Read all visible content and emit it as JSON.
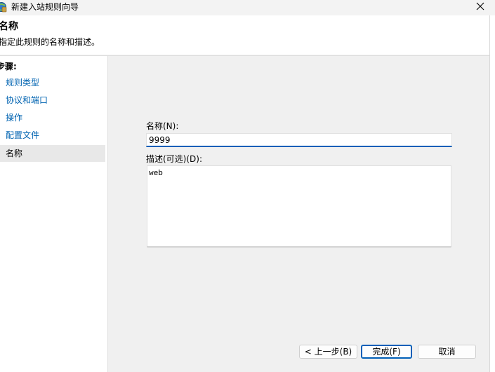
{
  "window": {
    "title": "新建入站规则向导",
    "close_symbol": "✕"
  },
  "header": {
    "title": "名称",
    "description": "指定此规则的名称和描述。"
  },
  "steps": {
    "heading": "步骤:",
    "items": [
      {
        "label": "规则类型"
      },
      {
        "label": "协议和端口"
      },
      {
        "label": "操作"
      },
      {
        "label": "配置文件"
      },
      {
        "label": "名称",
        "current": true
      }
    ]
  },
  "form": {
    "name_label": "名称(N):",
    "name_value": "9999",
    "description_label": "描述(可选)(D):",
    "description_value": "web"
  },
  "buttons": {
    "back": "< 上一步(B)",
    "finish": "完成(F)",
    "cancel": "取消"
  },
  "colors": {
    "accent": "#005fb8",
    "link": "#0063b1",
    "panel": "#ffffff",
    "background": "#f0f0f0"
  },
  "icons": {
    "app": "firewall-wizard-icon",
    "close": "close-icon"
  }
}
